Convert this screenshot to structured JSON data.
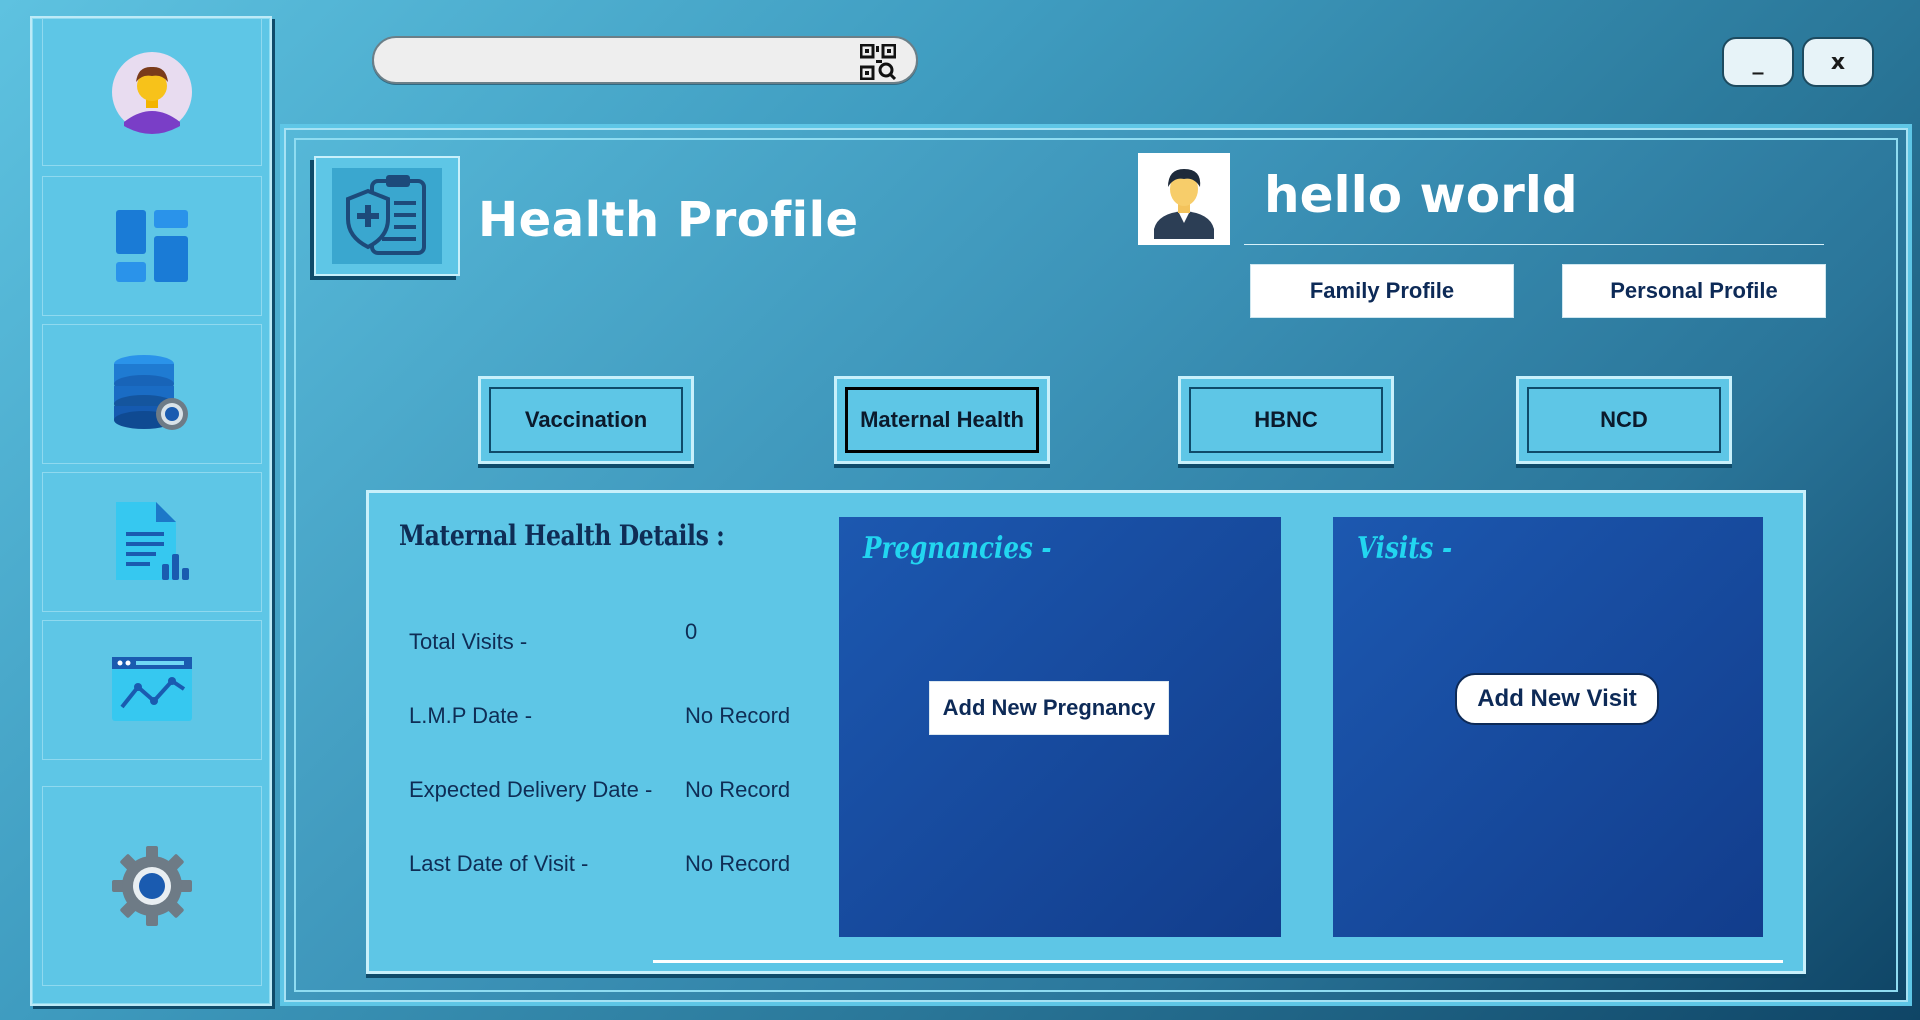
{
  "sidebar": {
    "items": [
      {
        "name": "profile",
        "icon": "user-avatar-icon"
      },
      {
        "name": "dashboard",
        "icon": "dashboard-grid-icon"
      },
      {
        "name": "database",
        "icon": "database-settings-icon"
      },
      {
        "name": "reports",
        "icon": "report-document-icon"
      },
      {
        "name": "analytics",
        "icon": "analytics-chart-icon"
      },
      {
        "name": "settings",
        "icon": "gear-icon"
      }
    ]
  },
  "search": {
    "value": "",
    "placeholder": "",
    "icon": "qr-code-icon"
  },
  "window": {
    "minimize_label": "_",
    "close_label": "x"
  },
  "header": {
    "title": "Health Profile",
    "user_name": "hello world",
    "family_profile_label": "Family Profile",
    "personal_profile_label": "Personal Profile"
  },
  "tabs": [
    {
      "label": "Vaccination",
      "active": false
    },
    {
      "label": "Maternal Health",
      "active": true
    },
    {
      "label": "HBNC",
      "active": false
    },
    {
      "label": "NCD",
      "active": false
    }
  ],
  "details": {
    "title": "Maternal Health Details :",
    "rows": [
      {
        "label": "Total Visits -",
        "value": "0"
      },
      {
        "label": "L.M.P Date -",
        "value": "No Record"
      },
      {
        "label": "Expected Delivery Date -",
        "value": "No Record"
      },
      {
        "label": "Last Date of Visit -",
        "value": "No Record"
      }
    ]
  },
  "pregnancies": {
    "title": "Pregnancies -",
    "add_label": "Add New Pregnancy"
  },
  "visits": {
    "title": "Visits -",
    "add_label": "Add New Visit"
  },
  "colors": {
    "accent": "#5ec6e6",
    "card": "#1c58b0",
    "card_title": "#22d6f0",
    "dark": "#0f4b6a"
  }
}
